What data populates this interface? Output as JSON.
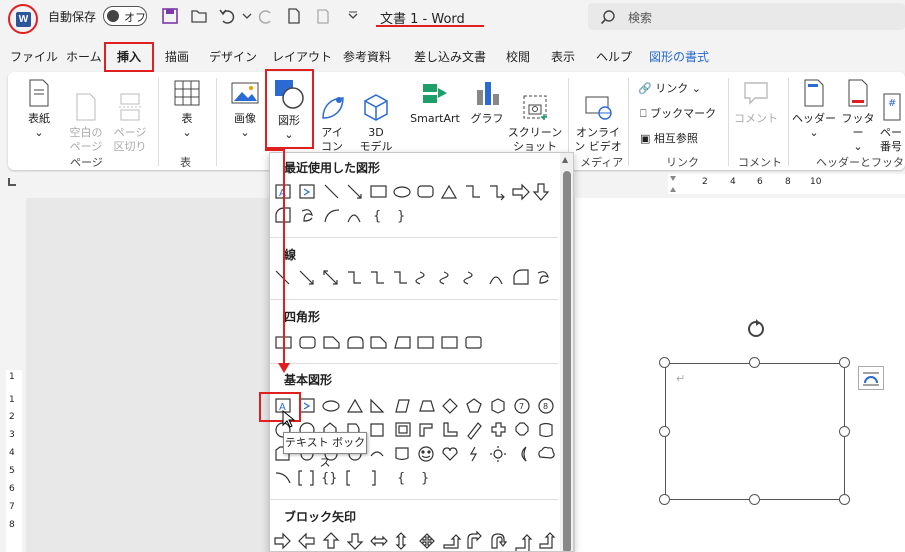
{
  "titlebar": {
    "autosave_label": "自動保存",
    "autosave_state": "オフ",
    "doc_title": "文書 1  -  Word",
    "search_placeholder": "検索"
  },
  "tabs": [
    "ファイル",
    "ホーム",
    "挿入",
    "描画",
    "デザイン",
    "レイアウト",
    "参考資料",
    "差し込み文書",
    "校閲",
    "表示",
    "ヘルプ",
    "図形の書式"
  ],
  "ribbon": {
    "cover": "表紙",
    "blank_page": "空白の\nページ",
    "page_break": "ページ\n区切り",
    "group_page": "ページ",
    "table": "表",
    "group_table": "表",
    "image": "画像",
    "shapes": "図形",
    "icons": "アイ\nコン",
    "model3d": "3D\nモデル",
    "smartart": "SmartArt",
    "graph": "グラフ",
    "screenshot": "スクリーン\nショット",
    "online_video": "オンライ\nン ビデオ",
    "group_media": "メディア",
    "link": "リンク",
    "bookmark": "ブックマーク",
    "cross_ref": "相互参照",
    "group_link": "リンク",
    "comment": "コメント",
    "group_comment": "コメント",
    "header": "ヘッダー",
    "footer": "フッター",
    "page_num": "ペー\n番号",
    "group_header_footer": "ヘッダーとフッター"
  },
  "ruler_numbers": [
    "2",
    "4",
    "6",
    "8",
    "10"
  ],
  "left_ruler_numbers": [
    "1",
    "1",
    "2",
    "3",
    "4",
    "5",
    "6",
    "7",
    "8"
  ],
  "dropdown": {
    "sections": {
      "recent": "最近使用した図形",
      "lines": "線",
      "rectangles": "四角形",
      "basic": "基本図形",
      "block_arrows": "ブロック矢印"
    },
    "tooltip": "テキスト ボックス"
  },
  "colors": {
    "accent_blue": "#2a6ad2",
    "highlight_red": "#e02020",
    "word_blue": "#2b579a"
  }
}
